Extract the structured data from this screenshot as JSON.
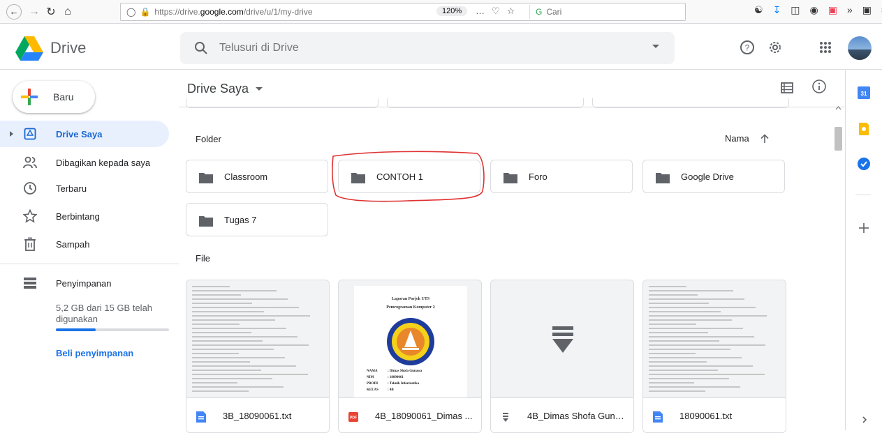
{
  "browser": {
    "url_prefix": "https://drive.",
    "url_domain": "google.com",
    "url_path": "/drive/u/1/my-drive",
    "zoom": "120%",
    "search_placeholder": "Cari",
    "more_glyph": "…"
  },
  "header": {
    "app_name": "Drive",
    "search_placeholder": "Telusuri di Drive"
  },
  "sidebar": {
    "new_label": "Baru",
    "items": [
      {
        "label": "Drive Saya",
        "icon": "my-drive-icon",
        "active": true
      },
      {
        "label": "Dibagikan kepada saya",
        "icon": "shared-icon"
      },
      {
        "label": "Terbaru",
        "icon": "clock-icon"
      },
      {
        "label": "Berbintang",
        "icon": "star-icon"
      },
      {
        "label": "Sampah",
        "icon": "trash-icon"
      }
    ],
    "storage_label": "Penyimpanan",
    "storage_text": "5,2 GB dari 15 GB telah digunakan",
    "storage_used_fraction": 0.35,
    "buy_label": "Beli penyimpanan"
  },
  "main": {
    "breadcrumb": "Drive Saya",
    "folder_section": "Folder",
    "sort_label": "Nama",
    "file_section": "File",
    "folders": [
      "Classroom",
      "CONTOH 1",
      "Foro",
      "Google Drive",
      "Tugas 7"
    ],
    "files": [
      {
        "name": "3B_18090061.txt",
        "type": "doc-icon"
      },
      {
        "name": "4B_18090061_Dimas ...",
        "type": "pdf-icon"
      },
      {
        "name": "4B_Dimas Shofa Guna...",
        "type": "text-file-icon"
      },
      {
        "name": "18090061.txt",
        "type": "doc-icon"
      }
    ],
    "pdf_preview": {
      "title": "Laporan Porjek UTS",
      "subtitle": "Pemrograman Komputer 2",
      "rows": [
        {
          "k": "NAMA",
          "v": ": Dimas Shofa Gunawa"
        },
        {
          "k": "NIM",
          "v": ": 18090061"
        },
        {
          "k": "PRODI",
          "v": ": Teknik Informatika"
        },
        {
          "k": "KELAS",
          "v": ": 4B"
        }
      ]
    }
  },
  "colors": {
    "accent": "#1a73e8",
    "active_bg": "#e8f0fe",
    "annotation": "#e03131"
  }
}
